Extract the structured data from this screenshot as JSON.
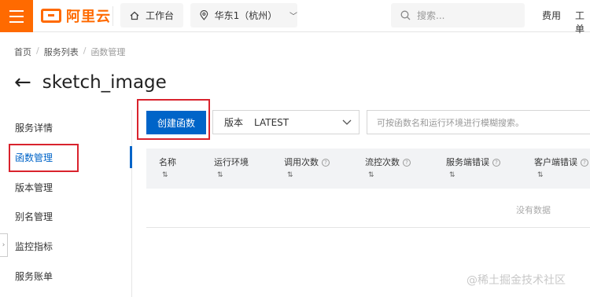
{
  "topbar": {
    "logo_text": "阿里云",
    "workbench_label": "工作台",
    "region_label": "华东1（杭州）",
    "search_placeholder": "搜索...",
    "nav_links": [
      "费用",
      "工单"
    ]
  },
  "breadcrumb": [
    "首页",
    "服务列表",
    "函数管理"
  ],
  "page": {
    "title": "sketch_image"
  },
  "sidebar": {
    "items": [
      {
        "label": "服务详情",
        "active": false
      },
      {
        "label": "函数管理",
        "active": true
      },
      {
        "label": "版本管理",
        "active": false
      },
      {
        "label": "别名管理",
        "active": false
      },
      {
        "label": "监控指标",
        "active": false
      },
      {
        "label": "服务账单",
        "active": false
      }
    ]
  },
  "toolbar": {
    "create_label": "创建函数",
    "version_label": "版本",
    "version_value": "LATEST",
    "filter_placeholder": "可按函数名和运行环境进行模糊搜索。"
  },
  "table": {
    "columns": [
      {
        "label": "名称",
        "help": false
      },
      {
        "label": "运行环境",
        "help": false
      },
      {
        "label": "调用次数",
        "help": true
      },
      {
        "label": "流控次数",
        "help": true
      },
      {
        "label": "服务端错误",
        "help": true
      },
      {
        "label": "客户端错误",
        "help": true
      }
    ],
    "sort_glyph": "⇅",
    "empty_text": "没有数据"
  },
  "watermark": "@稀土掘金技术社区",
  "colors": {
    "brand": "#ff6a00",
    "primary": "#0064c8",
    "highlight": "#d9232d"
  }
}
